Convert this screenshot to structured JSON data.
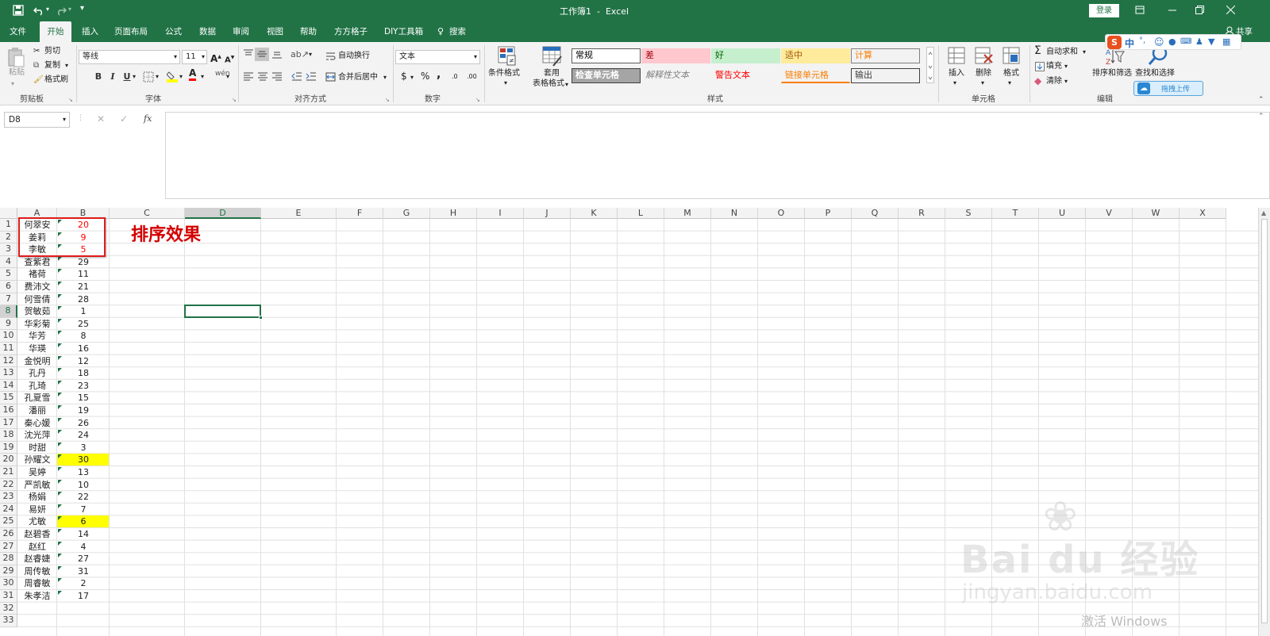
{
  "window": {
    "title": "工作簿1  -  Excel",
    "login": "登录",
    "share": "共享"
  },
  "qat": {
    "save_icon": "save-icon",
    "undo_icon": "undo-icon",
    "redo_icon": "redo-icon",
    "customize": "▾"
  },
  "tabs": [
    "文件",
    "开始",
    "插入",
    "页面布局",
    "公式",
    "数据",
    "审阅",
    "视图",
    "帮助",
    "方方格子",
    "DIY工具箱",
    "搜索"
  ],
  "ribbon": {
    "clipboard": {
      "paste": "粘贴",
      "cut": "剪切",
      "copy": "复制",
      "format_painter": "格式刷",
      "label": "剪贴板"
    },
    "font": {
      "name": "等线",
      "size": "11",
      "bold": "B",
      "italic": "I",
      "underline": "U",
      "label": "字体",
      "grow": "A",
      "shrink": "A",
      "font_color_letter": "A"
    },
    "align": {
      "wrap": "自动换行",
      "merge": "合并后居中",
      "label": "对齐方式"
    },
    "number": {
      "format": "文本",
      "currency": "$",
      "percent": "%",
      "comma": ",",
      "inc": ".0",
      "dec": ".00",
      "label": "数字"
    },
    "styles": {
      "cond": "条件格式",
      "table_line1": "套用",
      "table_line2": "表格格式",
      "label": "样式",
      "cells": [
        {
          "text": "常规",
          "color": "#000000",
          "bg": "#ffffff",
          "border": "#5c5c5c"
        },
        {
          "text": "差",
          "color": "#9c0006",
          "bg": "#ffc7ce",
          "border": "transparent"
        },
        {
          "text": "好",
          "color": "#006100",
          "bg": "#c6efce",
          "border": "transparent"
        },
        {
          "text": "适中",
          "color": "#9c5700",
          "bg": "#ffeb9c",
          "border": "transparent"
        },
        {
          "text": "计算",
          "color": "#fa7d00",
          "bg": "#f2f2f2",
          "border": "#7f7f7f"
        },
        {
          "text": "检查单元格",
          "color": "#ffffff",
          "bg": "#a5a5a5",
          "border": "#3f3f3f"
        },
        {
          "text": "解释性文本",
          "color": "#7f7f7f",
          "bg": "#f3f3f3",
          "border": "transparent"
        },
        {
          "text": "警告文本",
          "color": "#ff0000",
          "bg": "#f3f3f3",
          "border": "transparent"
        },
        {
          "text": "链接单元格",
          "color": "#fa7d00",
          "bg": "#f3f3f3",
          "border": "transparent"
        },
        {
          "text": "输出",
          "color": "#3f3f3f",
          "bg": "#f2f2f2",
          "border": "#3f3f3f"
        }
      ]
    },
    "cells": {
      "insert": "插入",
      "delete": "删除",
      "format": "格式",
      "label": "单元格"
    },
    "editing": {
      "autosum": "自动求和",
      "fill": "填充",
      "clear": "清除",
      "sort": "排序和筛选",
      "find": "查找和选择",
      "label": "编辑"
    },
    "upload": "拖拽上传"
  },
  "ime": {
    "mode": "中",
    "punct": "°,"
  },
  "formula_bar": {
    "name_box": "D8",
    "fx": "fx",
    "cancel": "✕",
    "enter": "✓",
    "content": ""
  },
  "sheet": {
    "columns": [
      "A",
      "B",
      "C",
      "D",
      "E",
      "F",
      "G",
      "H",
      "I",
      "J",
      "K",
      "L",
      "M",
      "N",
      "O",
      "P",
      "Q",
      "R",
      "S",
      "T",
      "U",
      "V",
      "W",
      "X"
    ],
    "row_numbers": [
      "1",
      "2",
      "3",
      "4",
      "5",
      "6",
      "7",
      "8",
      "9",
      "10",
      "11",
      "12",
      "13",
      "14",
      "15",
      "16",
      "17",
      "18",
      "19",
      "20",
      "21",
      "22",
      "23",
      "24",
      "25",
      "26",
      "27",
      "28",
      "29",
      "30",
      "31",
      "32",
      "33"
    ],
    "names": [
      "何翠安",
      "姜莉",
      "李敏",
      "查紫君",
      "褚荷",
      "费沛文",
      "何雪倩",
      "贺敏茹",
      "华彩菊",
      "华芳",
      "华瑛",
      "金悦明",
      "孔丹",
      "孔琦",
      "孔夏雪",
      "潘丽",
      "秦心媛",
      "沈光萍",
      "时甜",
      "孙耀文",
      "吴婷",
      "严凯敏",
      "杨娟",
      "易妍",
      "尤敏",
      "赵碧香",
      "赵红",
      "赵睿婕",
      "周传敏",
      "周睿敏",
      "朱孝洁"
    ],
    "values": [
      "20",
      "9",
      "5",
      "29",
      "11",
      "21",
      "28",
      "1",
      "25",
      "8",
      "16",
      "12",
      "18",
      "23",
      "15",
      "19",
      "26",
      "24",
      "3",
      "30",
      "13",
      "10",
      "22",
      "7",
      "6",
      "14",
      "4",
      "27",
      "31",
      "2",
      "17"
    ],
    "red_rows": [
      0,
      1,
      2
    ],
    "yellow_rows": [
      19,
      24
    ],
    "annotation": "排序效果",
    "selected_cell": "D8"
  },
  "watermark": {
    "brand": "Bai du 经验",
    "url": "jingyan.baidu.com",
    "activate": "激活 Windows"
  }
}
